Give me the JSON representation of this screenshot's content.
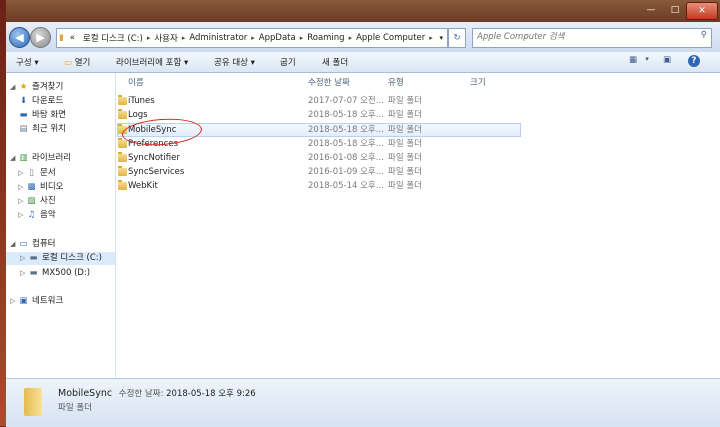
{
  "window_controls": {
    "minimize": "—",
    "maximize": "□",
    "close": "✕"
  },
  "address": {
    "crumbs": [
      "«",
      "로컬 디스크 (C:)",
      "사용자",
      "Administrator",
      "AppData",
      "Roaming",
      "Apple Computer"
    ],
    "search_placeholder": "Apple Computer 검색"
  },
  "toolbar": {
    "organize": "구성 ▾",
    "open": "열기",
    "include_library": "라이브러리에 포함 ▾",
    "share": "공유 대상 ▾",
    "burn": "굽기",
    "new_folder": "새 폴더"
  },
  "nav": {
    "favorites": "즐겨찾기",
    "downloads": "다운로드",
    "desktop": "바탕 화면",
    "recent": "최근 위치",
    "libraries": "라이브러리",
    "documents": "문서",
    "videos": "비디오",
    "pictures": "사진",
    "music": "음악",
    "computer": "컴퓨터",
    "local_disk": "로컬 디스크 (C:)",
    "mx500": "MX500 (D:)",
    "network": "네트워크"
  },
  "columns": {
    "name": "이름",
    "modified": "수정한 날짜",
    "type": "유형",
    "size": "크기"
  },
  "files": [
    {
      "name": "iTunes",
      "modified": "2017-07-07 오전...",
      "type": "파일 폴더"
    },
    {
      "name": "Logs",
      "modified": "2018-05-18 오후...",
      "type": "파일 폴더"
    },
    {
      "name": "MobileSync",
      "modified": "2018-05-18 오후...",
      "type": "파일 폴더"
    },
    {
      "name": "Preferences",
      "modified": "2018-05-18 오후...",
      "type": "파일 폴더"
    },
    {
      "name": "SyncNotifier",
      "modified": "2016-01-08 오후...",
      "type": "파일 폴더"
    },
    {
      "name": "SyncServices",
      "modified": "2016-01-09 오후...",
      "type": "파일 폴더"
    },
    {
      "name": "WebKit",
      "modified": "2018-05-14 오후...",
      "type": "파일 폴더"
    }
  ],
  "details": {
    "name": "MobileSync",
    "modified_label": "수정한 날짜:",
    "modified_value": "2018-05-18 오후 9:26",
    "type": "파일 폴더"
  }
}
